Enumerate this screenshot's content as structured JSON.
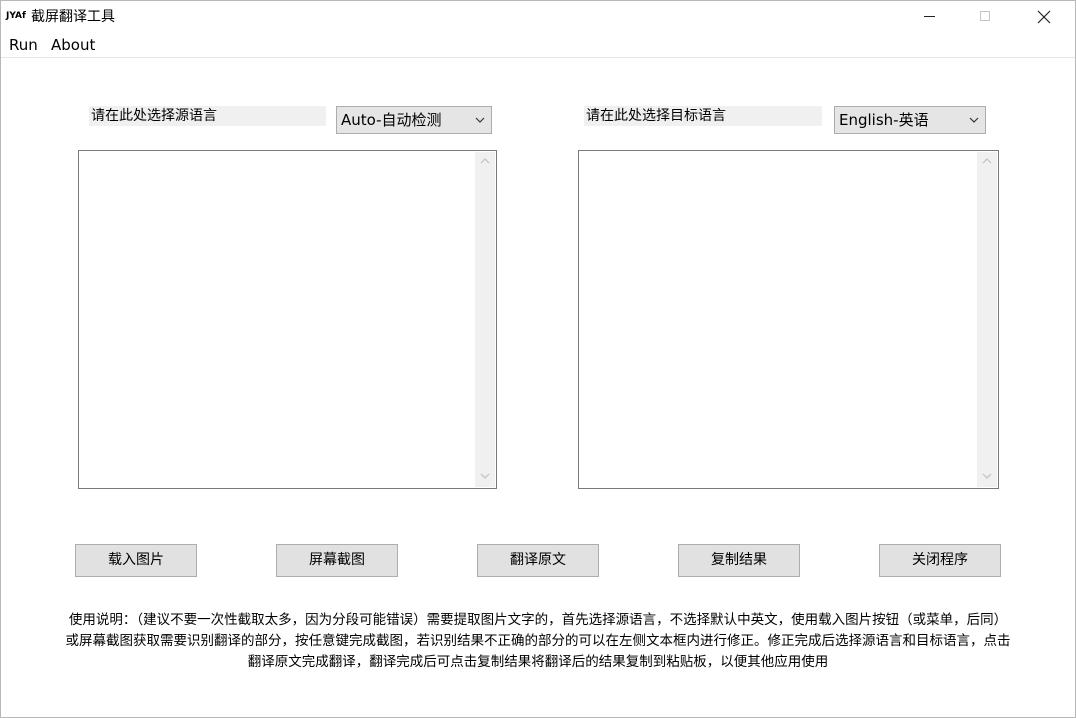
{
  "titlebar": {
    "logo_text": "JYAf",
    "title": "截屏翻译工具",
    "minimize_icon": "minimize-icon",
    "maximize_icon": "maximize-icon",
    "close_icon": "close-icon"
  },
  "menu": {
    "items": [
      "Run",
      "About"
    ]
  },
  "source": {
    "label": "请在此处选择源语言",
    "selected": "Auto-自动检测",
    "text": ""
  },
  "target": {
    "label": "请在此处选择目标语言",
    "selected": "English-英语",
    "text": ""
  },
  "buttons": {
    "load_image": "载入图片",
    "screenshot": "屏幕截图",
    "translate": "翻译原文",
    "copy_result": "复制结果",
    "close_app": "关闭程序"
  },
  "instructions": "使用说明：（建议不要一次性截取太多，因为分段可能错误）需要提取图片文字的，首先选择源语言，不选择默认中英文，使用载入图片按钮（或菜单，后同）或屏幕截图获取需要识别翻译的部分，按任意键完成截图，若识别结果不正确的部分的可以在左侧文本框内进行修正。修正完成后选择源语言和目标语言，点击翻译原文完成翻译，翻译完成后可点击复制结果将翻译后的结果复制到粘贴板，以便其他应用使用"
}
